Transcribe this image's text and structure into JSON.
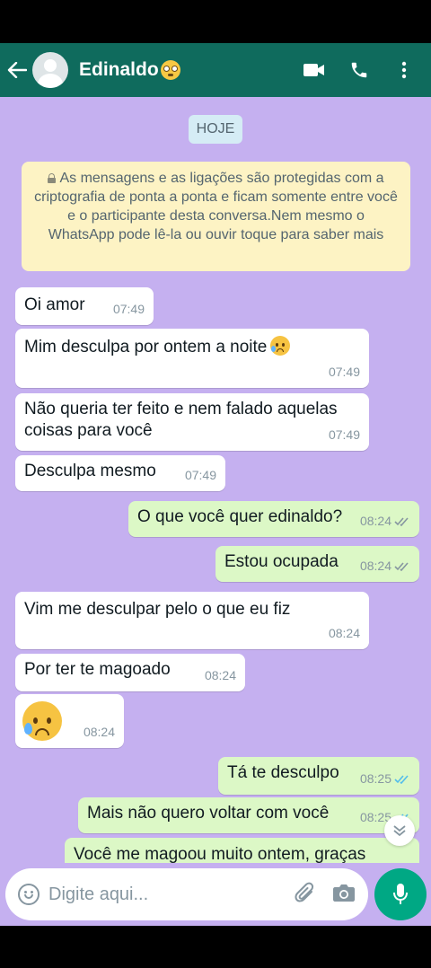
{
  "header": {
    "contact_name": "Edinaldo",
    "contact_emoji": "flushed-face",
    "bg_color": "#0f6b5d",
    "icons": [
      "back-arrow-icon",
      "video-call-icon",
      "phone-call-icon",
      "more-options-icon"
    ]
  },
  "chat": {
    "date_label": "HOJE",
    "encryption_notice": "As mensagens e as ligações são protegidas com a criptografia de ponta a ponta e ficam  somente entre você e o participante desta conversa.Nem mesmo o WhatsApp pode lê-la ou ouvir toque para saber mais",
    "messages": [
      {
        "direction": "in",
        "text": "Oi amor",
        "time": "07:49"
      },
      {
        "direction": "in",
        "text": "Mim desculpa por ontem a noite",
        "emoji": "sad-but-relieved-face",
        "time": "07:49"
      },
      {
        "direction": "in",
        "text_line1": "Não queria ter feito e nem falado aquelas",
        "text_line2": "coisas para você",
        "time": "07:49"
      },
      {
        "direction": "in",
        "text": "Desculpa mesmo",
        "time": "07:49"
      },
      {
        "direction": "out",
        "text": "O que você quer edinaldo?",
        "time": "08:24",
        "status": "delivered"
      },
      {
        "direction": "out",
        "text": "Estou ocupada",
        "time": "08:24",
        "status": "delivered"
      },
      {
        "direction": "in",
        "text": "Vim me desculpar pelo o que eu fiz",
        "time": "08:24"
      },
      {
        "direction": "in",
        "text": "Por ter te magoado",
        "time": "08:24"
      },
      {
        "direction": "in",
        "emoji": "sad-but-relieved-face",
        "time": "08:24"
      },
      {
        "direction": "out",
        "text": "Tá te desculpo",
        "time": "08:25",
        "status": "read"
      },
      {
        "direction": "out",
        "text": "Mais não quero voltar com você",
        "time": "08:25",
        "status": "read"
      },
      {
        "direction": "out",
        "text": "Você me magoou muito ontem, graças",
        "partial": true
      }
    ]
  },
  "composer": {
    "placeholder": "Digite aqui...",
    "icons": [
      "emoji-icon",
      "attach-icon",
      "camera-icon",
      "mic-icon"
    ]
  },
  "colors": {
    "chat_bg": "#c5b0f0",
    "incoming": "#ffffff",
    "outgoing": "#dcf8c6",
    "notice": "#fdf3c4",
    "read_ticks": "#53bdeb",
    "accent": "#00a884"
  }
}
